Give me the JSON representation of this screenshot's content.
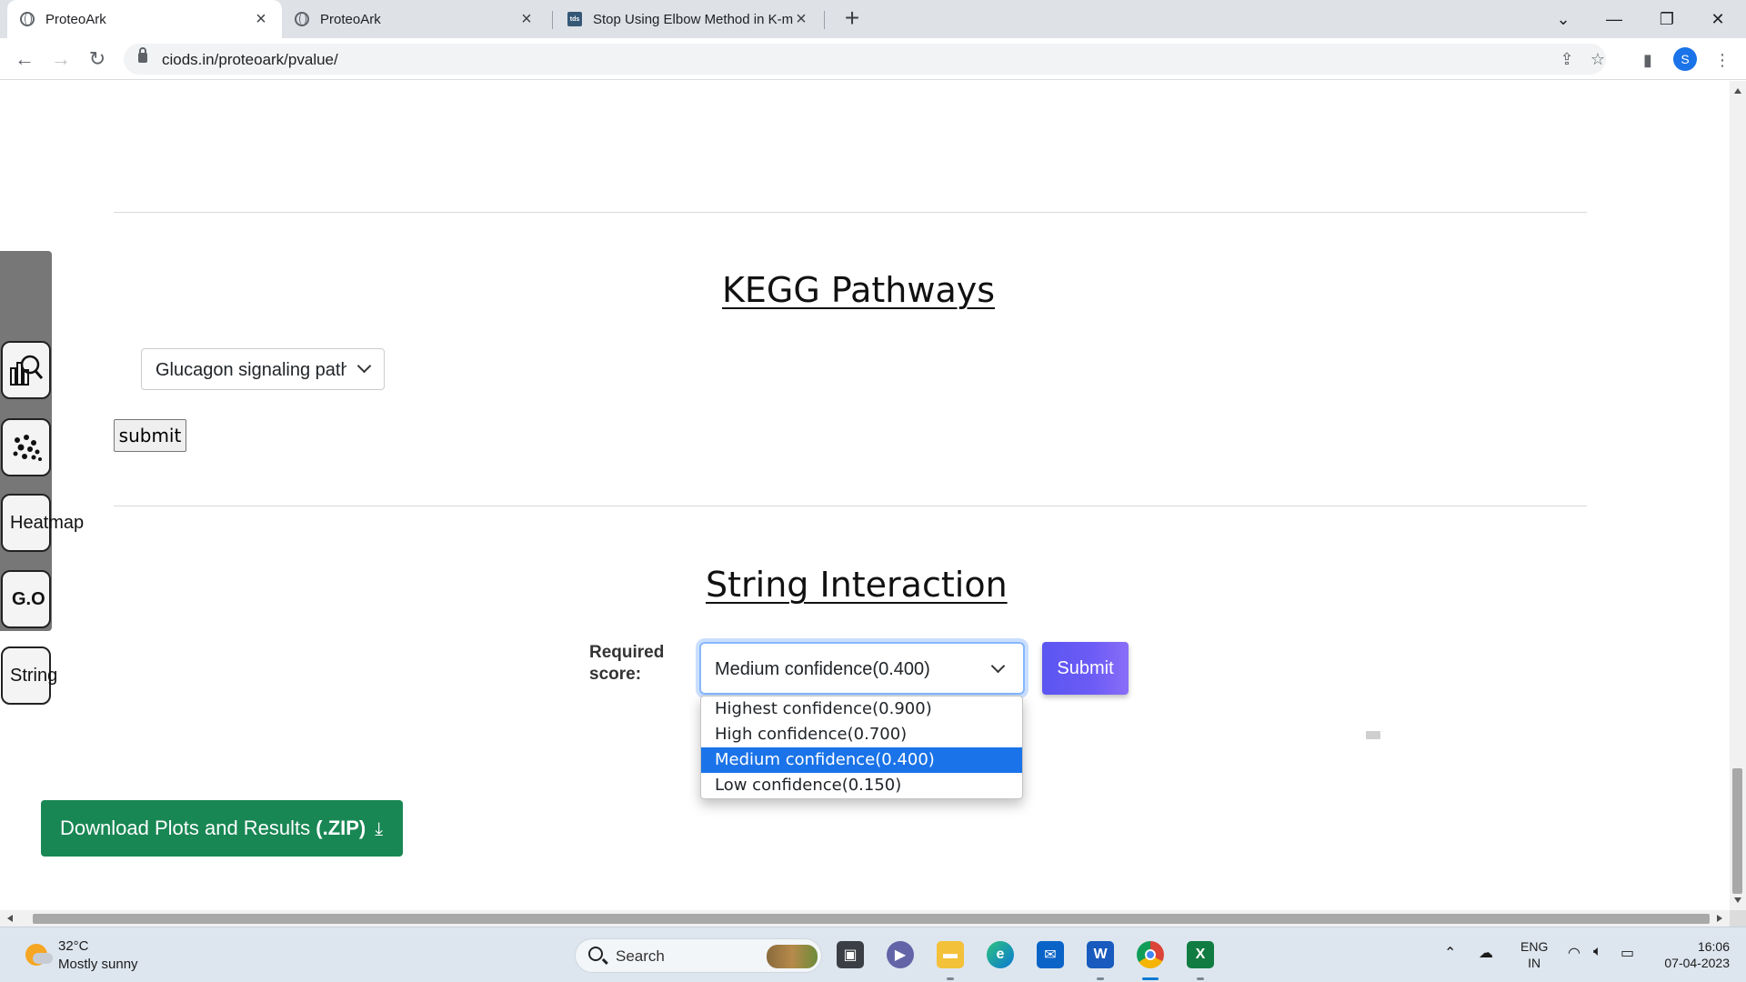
{
  "browser": {
    "tabs": [
      {
        "title": "ProteoArk",
        "active": true
      },
      {
        "title": "ProteoArk",
        "active": false
      },
      {
        "title": "Stop Using Elbow Method in K-m",
        "active": false
      }
    ],
    "favicon_tds": "tds",
    "url": "ciods.in/proteoark/pvalue/",
    "profile_initial": "S"
  },
  "page": {
    "kegg": {
      "title": "KEGG Pathways",
      "selected_pathway": "Glucagon signaling pathway",
      "submit_label": "submit"
    },
    "string": {
      "title": "String Interaction",
      "required_label": "Required score:",
      "selected": "Medium confidence(0.400)",
      "options": [
        "Highest confidence(0.900)",
        "High confidence(0.700)",
        "Medium confidence(0.400)",
        "Low confidence(0.150)"
      ],
      "submit_label": "Submit"
    },
    "download": {
      "label": "Download Plots and Results ",
      "ext": "(.ZIP)"
    },
    "sidebar": {
      "heatmap_label": "Heatmap",
      "go_label": "G.O",
      "string_label": "String"
    }
  },
  "taskbar": {
    "temp": "32°C",
    "weather": "Mostly sunny",
    "search_placeholder": "Search",
    "lang_top": "ENG",
    "lang_bottom": "IN",
    "time": "16:06",
    "date": "07-04-2023"
  },
  "colors": {
    "download_green": "#198754",
    "submit_gradient_start": "#5b55f2",
    "option_selected": "#1a73e8"
  }
}
